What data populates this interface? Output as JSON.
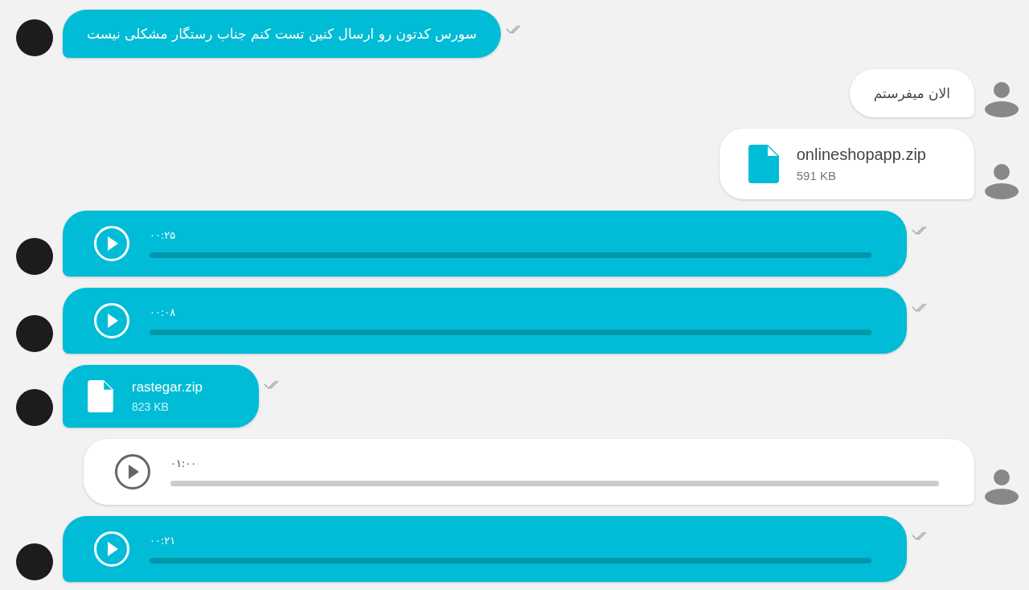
{
  "messages": [
    {
      "from_me": false,
      "kind": "text",
      "text": "سورس کدتون رو ارسال کنین تست کنم جناب رستگار مشکلی نیست"
    },
    {
      "from_me": true,
      "kind": "text",
      "text": "الان میفرستم"
    },
    {
      "from_me": true,
      "kind": "file",
      "name": "onlineshopapp.zip",
      "size": "591 KB"
    },
    {
      "from_me": false,
      "kind": "voice",
      "duration": "۰۰:۲۵"
    },
    {
      "from_me": false,
      "kind": "voice",
      "duration": "۰۰:۰۸"
    },
    {
      "from_me": false,
      "kind": "file",
      "name": "rastegar.zip",
      "size": "823 KB"
    },
    {
      "from_me": true,
      "kind": "voice",
      "duration": "۰۱:۰۰"
    },
    {
      "from_me": false,
      "kind": "voice",
      "duration": "۰۰:۲۱"
    }
  ]
}
